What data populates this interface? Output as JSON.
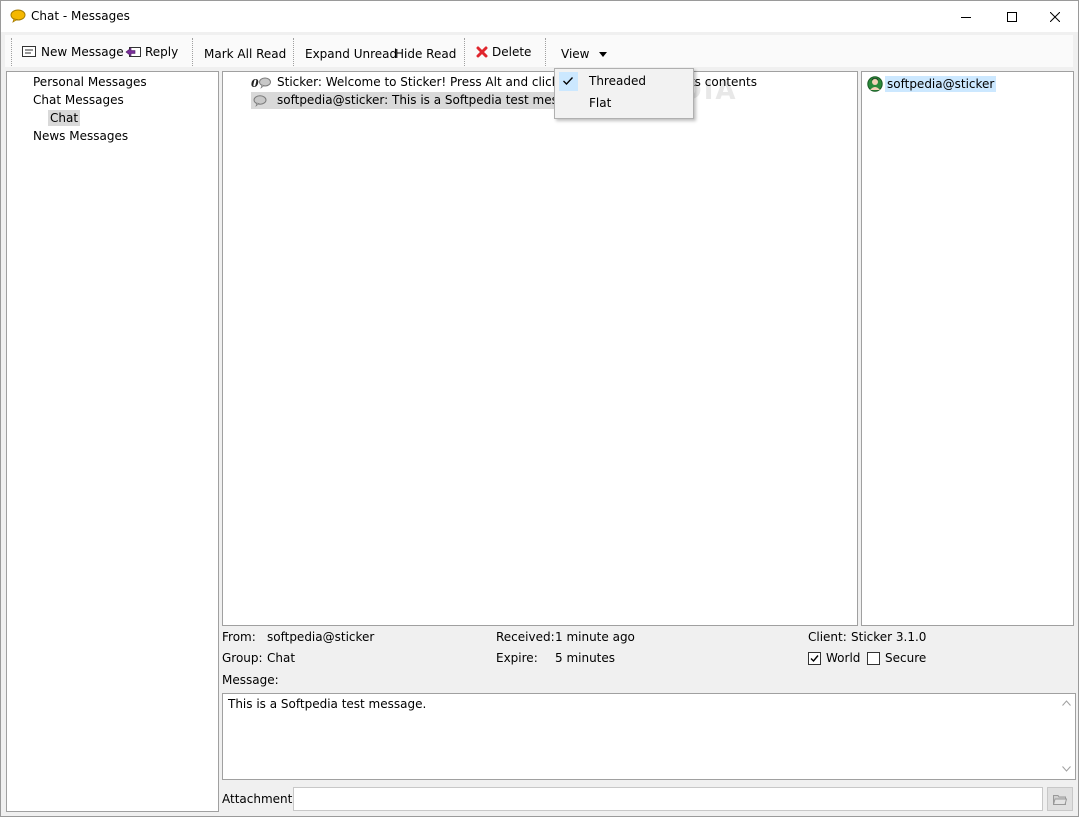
{
  "window": {
    "title": "Chat - Messages"
  },
  "toolbar": {
    "new_message": "New Message",
    "reply": "Reply",
    "mark_all_read": "Mark All Read",
    "expand_unread": "Expand Unread",
    "hide_read": "Hide Read",
    "delete": "Delete",
    "view": "View"
  },
  "tree": {
    "items": [
      {
        "label": "Personal Messages"
      },
      {
        "label": "Chat Messages"
      },
      {
        "label": "Chat"
      },
      {
        "label": "News Messages"
      }
    ]
  },
  "messages": [
    {
      "text": "Sticker: Welcome to Sticker! Press Alt and click this message to see its contents"
    },
    {
      "text": "softpedia@sticker: This is a Softpedia test message."
    }
  ],
  "watermark": "SOFTPEDIA",
  "users": [
    {
      "name": "softpedia@sticker"
    }
  ],
  "details": {
    "from_label": "From:",
    "from_value": "softpedia@sticker",
    "group_label": "Group:",
    "group_value": "Chat",
    "received_label": "Received:",
    "received_value": "1 minute ago",
    "expire_label": "Expire:",
    "expire_value": "5 minutes",
    "client_label": "Client:",
    "client_value": "Sticker 3.1.0",
    "world_label": "World",
    "world_checked": true,
    "secure_label": "Secure",
    "secure_checked": false,
    "message_label": "Message:",
    "message_body": "This is a Softpedia test message.",
    "attachment_label": "Attachment:",
    "attachment_value": ""
  },
  "view_menu": {
    "options": [
      {
        "label": "Threaded",
        "checked": true
      },
      {
        "label": "Flat",
        "checked": false
      }
    ]
  },
  "colors": {
    "accent": "#cce8ff",
    "selection": "#d9d9d9",
    "delete_icon": "#e0262d",
    "app_icon": "#f5b800"
  }
}
